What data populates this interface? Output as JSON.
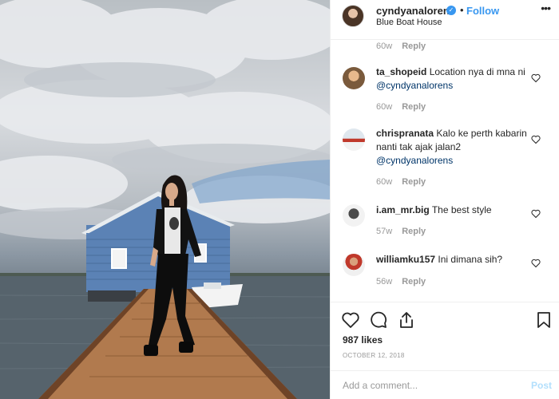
{
  "post": {
    "username": "cyndyanalorens",
    "verified_icon": "verified-badge-icon",
    "dot": "•",
    "follow_label": "Follow",
    "location": "Blue Boat House",
    "more_icon": "more-options-icon"
  },
  "comments": [
    {
      "username": "",
      "text": "",
      "age": "60w",
      "reply": "Reply"
    },
    {
      "username": "ta_shopeid",
      "text": "Location nya di mna ni",
      "mention": "@cyndyanalorens",
      "age": "60w",
      "reply": "Reply"
    },
    {
      "username": "chrispranata",
      "text": "Kalo ke perth kabarin nanti tak ajak jalan2",
      "mention": "@cyndyanalorens",
      "age": "60w",
      "reply": "Reply"
    },
    {
      "username": "i.am_mr.big",
      "text": "The best style",
      "age": "57w",
      "reply": "Reply"
    },
    {
      "username": "williamku157",
      "text": "Ini dimana sih?",
      "age": "56w",
      "reply": "Reply"
    }
  ],
  "actions": {
    "icons": [
      "heart-icon",
      "comment-icon",
      "share-icon",
      "bookmark-icon"
    ],
    "likes": "987 likes",
    "date": "OCTOBER 12, 2018"
  },
  "add_comment": {
    "placeholder": "Add a comment...",
    "post_label": "Post"
  },
  "colors": {
    "accent": "#3897f0",
    "text": "#262626",
    "muted": "#999999",
    "post_disabled": "#b2dffc"
  }
}
